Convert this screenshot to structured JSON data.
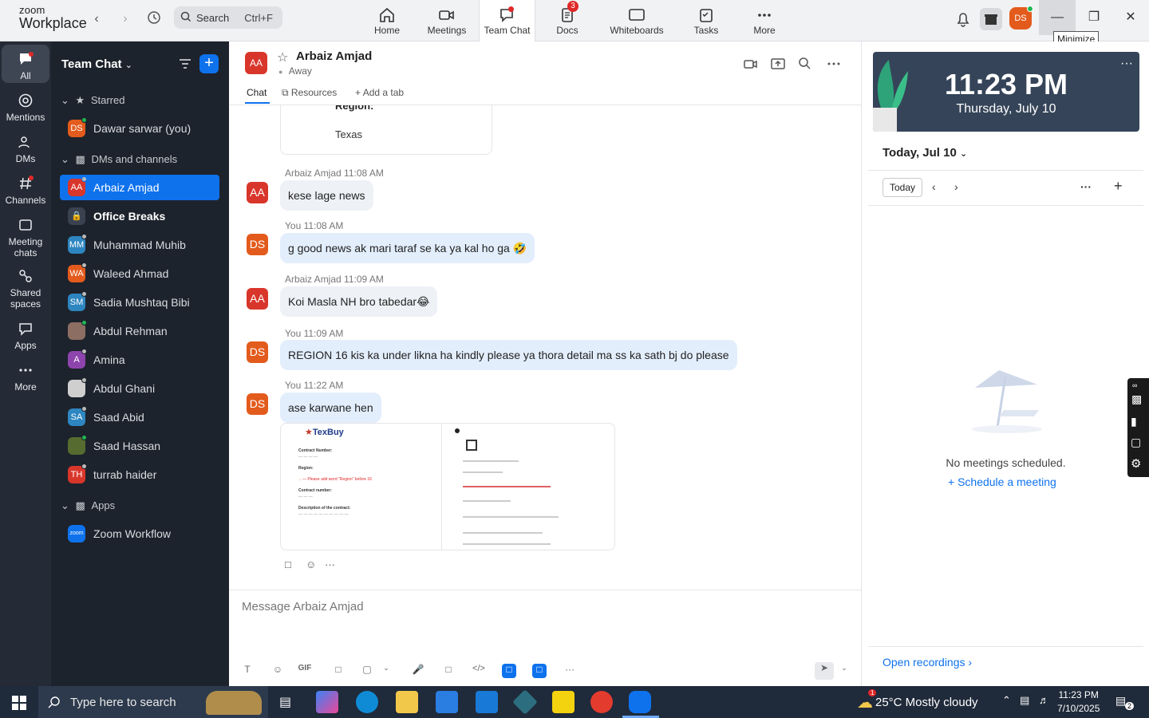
{
  "app": {
    "logo_line1": "zoom",
    "logo_line2": "Workplace"
  },
  "search": {
    "label": "Search",
    "shortcut": "Ctrl+F"
  },
  "nav": [
    {
      "label": "Home",
      "icon": "home-icon"
    },
    {
      "label": "Meetings",
      "icon": "video-icon"
    },
    {
      "label": "Team Chat",
      "icon": "chat-icon"
    },
    {
      "label": "Docs",
      "icon": "docs-icon",
      "badge": "3"
    },
    {
      "label": "Whiteboards",
      "icon": "whiteboard-icon"
    },
    {
      "label": "Tasks",
      "icon": "tasks-icon"
    },
    {
      "label": "More",
      "icon": "more-icon"
    }
  ],
  "profile": {
    "initials": "DS"
  },
  "window": {
    "tooltip": "Minimize"
  },
  "rail": [
    {
      "label": "All"
    },
    {
      "label": "Mentions"
    },
    {
      "label": "DMs"
    },
    {
      "label": "Channels"
    },
    {
      "label": "Meeting chats"
    },
    {
      "label": "Shared spaces"
    },
    {
      "label": "Apps"
    },
    {
      "label": "More"
    }
  ],
  "sidebar": {
    "title": "Team Chat",
    "sections": {
      "starred": "Starred",
      "dms": "DMs and channels",
      "apps": "Apps"
    },
    "starred": [
      {
        "initials": "DS",
        "name": "Dawar sarwar (you)",
        "color": "#e35b1c"
      }
    ],
    "items": [
      {
        "initials": "AA",
        "name": "Arbaiz Amjad",
        "color": "#d9362b"
      },
      {
        "initials": "",
        "name": "Office Breaks",
        "color": "#3a4250"
      },
      {
        "initials": "MM",
        "name": "Muhammad Muhib",
        "color": "#2e86c1"
      },
      {
        "initials": "WA",
        "name": "Waleed Ahmad",
        "color": "#e35b1c"
      },
      {
        "initials": "SM",
        "name": "Sadia Mushtaq Bibi",
        "color": "#2e86c1"
      },
      {
        "initials": "",
        "name": "Abdul Rehman",
        "color": "#8d6e63"
      },
      {
        "initials": "A",
        "name": "Amina",
        "color": "#8e44ad"
      },
      {
        "initials": "",
        "name": "Abdul Ghani",
        "color": "#cfcfcf"
      },
      {
        "initials": "SA",
        "name": "Saad Abid",
        "color": "#2e86c1"
      },
      {
        "initials": "",
        "name": "Saad Hassan",
        "color": "#556b2f"
      },
      {
        "initials": "TH",
        "name": "turrab haider",
        "color": "#d9362b"
      }
    ],
    "apps": [
      {
        "initials": "zoom",
        "name": "Zoom Workflow",
        "color": "#0e72ed"
      }
    ]
  },
  "chat": {
    "header": {
      "initials": "AA",
      "name": "Arbaiz Amjad",
      "status": "Away"
    },
    "tabs": [
      "Chat",
      "Resources",
      "Add a tab"
    ],
    "prev_card": {
      "line1": "Region:",
      "line2": "Texas"
    },
    "messages": [
      {
        "sender": "Arbaiz Amjad",
        "time": "11:08 AM",
        "initials": "AA",
        "text": "kese lage news",
        "mine": false
      },
      {
        "sender": "You",
        "time": "11:08 AM",
        "initials": "DS",
        "text": "g good news ak mari taraf se ka ya kal ho ga 🤣",
        "mine": true
      },
      {
        "sender": "Arbaiz Amjad",
        "time": "11:09 AM",
        "initials": "AA",
        "text": "Koi Masla NH bro tabedar😂",
        "mine": false
      },
      {
        "sender": "You",
        "time": "11:09 AM",
        "initials": "DS",
        "text": "REGION 16 kis ka under likna ha kindly please ya thora detail ma ss ka sath bj do please",
        "mine": true
      },
      {
        "sender": "You",
        "time": "11:22 AM",
        "initials": "DS",
        "text": "ase karwane hen",
        "mine": true
      }
    ],
    "attachment": {
      "left": {
        "brand": "TexBuy",
        "lines": [
          "Contract Number:",
          "Region:",
          "Contract number:",
          "Description of the contract:"
        ],
        "annotation": "Please add word \"Region\" before 16"
      }
    },
    "composer": {
      "placeholder": "Message Arbaiz Amjad"
    }
  },
  "calendar": {
    "time": "11:23 PM",
    "date": "Thursday, July 10",
    "day_selector": "Today, Jul 10",
    "today_btn": "Today",
    "empty": "No meetings scheduled.",
    "schedule": "Schedule a meeting",
    "open_recordings": "Open recordings"
  },
  "taskbar": {
    "search": "Type here to search",
    "weather": "25°C  Mostly cloudy",
    "weather_badge": "1",
    "time": "11:23 PM",
    "date": "7/10/2025",
    "notif": "2"
  },
  "colors": {
    "accent": "#0e72ed",
    "sidebar": "#1d232c",
    "rail": "#242b36"
  }
}
